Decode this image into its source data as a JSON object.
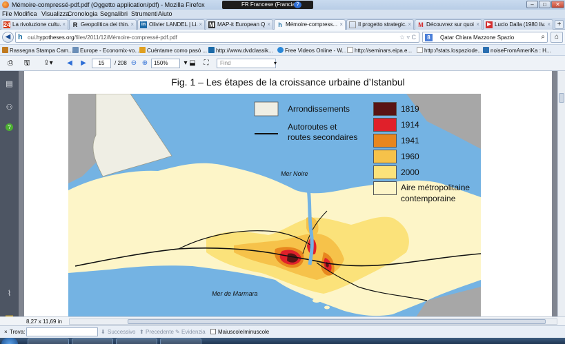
{
  "window": {
    "title": "Mémoire-compressé-pdf.pdf (Oggetto application/pdf) - Mozilla Firefox",
    "language_bar": "FR Francese (Francia)",
    "language_help": "?"
  },
  "menu": [
    "File",
    "Modifica",
    "Visualizza",
    "Cronologia",
    "Segnalibri",
    "Strumenti",
    "Aiuto"
  ],
  "tabs": [
    {
      "icon": "24",
      "icon_color": "#d83a1a",
      "label": "La rivoluzione cultu..."
    },
    {
      "icon": "R",
      "icon_color": "#111111",
      "label": "Geopolitica dei thin..."
    },
    {
      "icon": "in",
      "icon_color": "#1b6aa8",
      "label": "Olivier LANDEL | Li..."
    },
    {
      "icon": "M",
      "icon_color": "#333333",
      "label": "MAP-it European Q..."
    },
    {
      "icon": "h",
      "icon_color": "#1d6fa3",
      "label": "Mémoire-compress...",
      "active": true
    },
    {
      "icon": "",
      "icon_color": "#888888",
      "label": "Il progetto strategic..."
    },
    {
      "icon": "M",
      "icon_color": "#d32f2f",
      "label": "Découvrez sur quoi ..."
    },
    {
      "icon": "▶",
      "icon_color": "#d32f2f",
      "label": "Lucio Dalla (1980 liv..."
    }
  ],
  "nav": {
    "url_prefix": "oui.",
    "url_host": "hypotheses.org",
    "url_path": "/files/2011/12/Mémoire-compressé-pdf.pdf",
    "search_text": "Qatar Chiara Mazzone Spazio"
  },
  "bookmarks": [
    {
      "label": "Rassegna Stampa Cam...",
      "color": "#c07a20"
    },
    {
      "label": "Europe - Economix-vo...",
      "color": "#6b8fb8"
    },
    {
      "label": "Cuéntame como pasó ...",
      "color": "#e0a020"
    },
    {
      "label": "http://www.dvdclassik...",
      "color": "#1b6aa8"
    },
    {
      "label": "Free Videos Online - W...",
      "color": "#2a88d8"
    },
    {
      "label": "http://seminars.eipa.e...",
      "color": "#dddddd"
    },
    {
      "label": "http://stats.lospaziode...",
      "color": "#dddddd"
    },
    {
      "label": "noiseFromAmeriKa : H...",
      "color": "#2a6fb0"
    }
  ],
  "pdf": {
    "current_page": "15",
    "total_pages": "/ 208",
    "zoom": "150%",
    "find_placeholder": "Find",
    "page_size": "8,27 x 11,69 in"
  },
  "figure": {
    "title": "Fig. 1 – Les étapes de la croissance urbaine d’Istanbul",
    "label_black_sea": "Mer Noire",
    "label_marmara": "Mer de Marmara",
    "legend_left": [
      {
        "label": "Arrondissements"
      },
      {
        "label": "Autoroutes et"
      },
      {
        "label": "routes secondaires"
      }
    ],
    "legend_right": [
      {
        "label": "1819",
        "color": "#5a1414"
      },
      {
        "label": "1914",
        "color": "#e0202a"
      },
      {
        "label": "1941",
        "color": "#e8861e"
      },
      {
        "label": "1960",
        "color": "#f6c24a"
      },
      {
        "label": "2000",
        "color": "#fbe27a"
      },
      {
        "label": "Aire métropolitaine",
        "color": "#fdf5c8"
      },
      {
        "label": "contemporaine",
        "color": ""
      }
    ],
    "colors": {
      "sea": "#74b3e3",
      "land_outside": "#a7a7a7",
      "arrondissements": "#efeee4"
    }
  },
  "findbar": {
    "close": "×",
    "label": "Trova:",
    "next": "Successivo",
    "previous": "Precedente",
    "highlight": "Evidenzia",
    "match_case": "Maiuscole/minuscole"
  }
}
